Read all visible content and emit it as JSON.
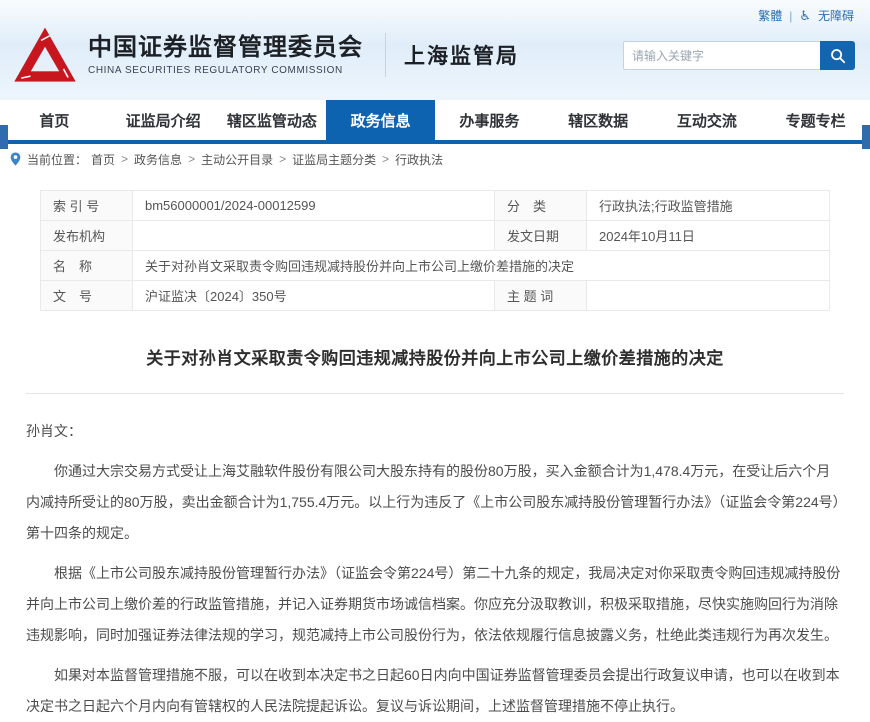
{
  "topbar": {
    "traditional_label": "繁體",
    "divider": "|",
    "accessibility_label": "无障碍"
  },
  "header": {
    "org_name_cn": "中国证券监督管理委员会",
    "org_name_en": "CHINA SECURITIES REGULATORY COMMISSION",
    "bureau_name": "上海监管局",
    "search": {
      "placeholder": "请输入关键字"
    }
  },
  "nav": {
    "items": [
      "首页",
      "证监局介绍",
      "辖区监管动态",
      "政务信息",
      "办事服务",
      "辖区数据",
      "互动交流",
      "专题专栏"
    ],
    "active_label": "政务信息"
  },
  "breadcrumb": {
    "prefix": "当前位置：",
    "separator": ">",
    "items": [
      "首页",
      "政务信息",
      "主动公开目录",
      "证监局主题分类",
      "行政执法"
    ]
  },
  "doc_meta": {
    "index_label": "索 引 号",
    "index_value": "bm56000001/2024-00012599",
    "category_label": "分　类",
    "category_value": "行政执法;行政监管措施",
    "publisher_label": "发布机构",
    "publisher_value": "",
    "date_label": "发文日期",
    "date_value": "2024年10月11日",
    "name_label": "名　称",
    "name_value": "关于对孙肖文采取责令购回违规减持股份并向上市公司上缴价差措施的决定",
    "doc_no_label": "文　号",
    "doc_no_value": "沪证监决〔2024〕350号",
    "keywords_label": "主 题 词",
    "keywords_value": ""
  },
  "article": {
    "title": "关于对孙肖文采取责令购回违规减持股份并向上市公司上缴价差措施的决定",
    "salutation": "孙肖文：",
    "paragraphs": [
      "你通过大宗交易方式受让上海艾融软件股份有限公司大股东持有的股份80万股，买入金额合计为1,478.4万元，在受让后六个月内减持所受让的80万股，卖出金额合计为1,755.4万元。以上行为违反了《上市公司股东减持股份管理暂行办法》（证监会令第224号）第十四条的规定。",
      "根据《上市公司股东减持股份管理暂行办法》（证监会令第224号）第二十九条的规定，我局决定对你采取责令购回违规减持股份并向上市公司上缴价差的行政监管措施，并记入证券期货市场诚信档案。你应充分汲取教训，积极采取措施，尽快实施购回行为消除违规影响，同时加强证券法律法规的学习，规范减持上市公司股份行为，依法依规履行信息披露义务，杜绝此类违规行为再次发生。",
      "如果对本监督管理措施不服，可以在收到本决定书之日起60日内向中国证券监督管理委员会提出行政复议申请，也可以在收到本决定书之日起六个月内向有管辖权的人民法院提起诉讼。复议与诉讼期间，上述监督管理措施不停止执行。"
    ]
  },
  "colors": {
    "accent_blue": "#0e63b0",
    "logo_red": "#c8161e",
    "link_blue": "#2b6cb4"
  }
}
